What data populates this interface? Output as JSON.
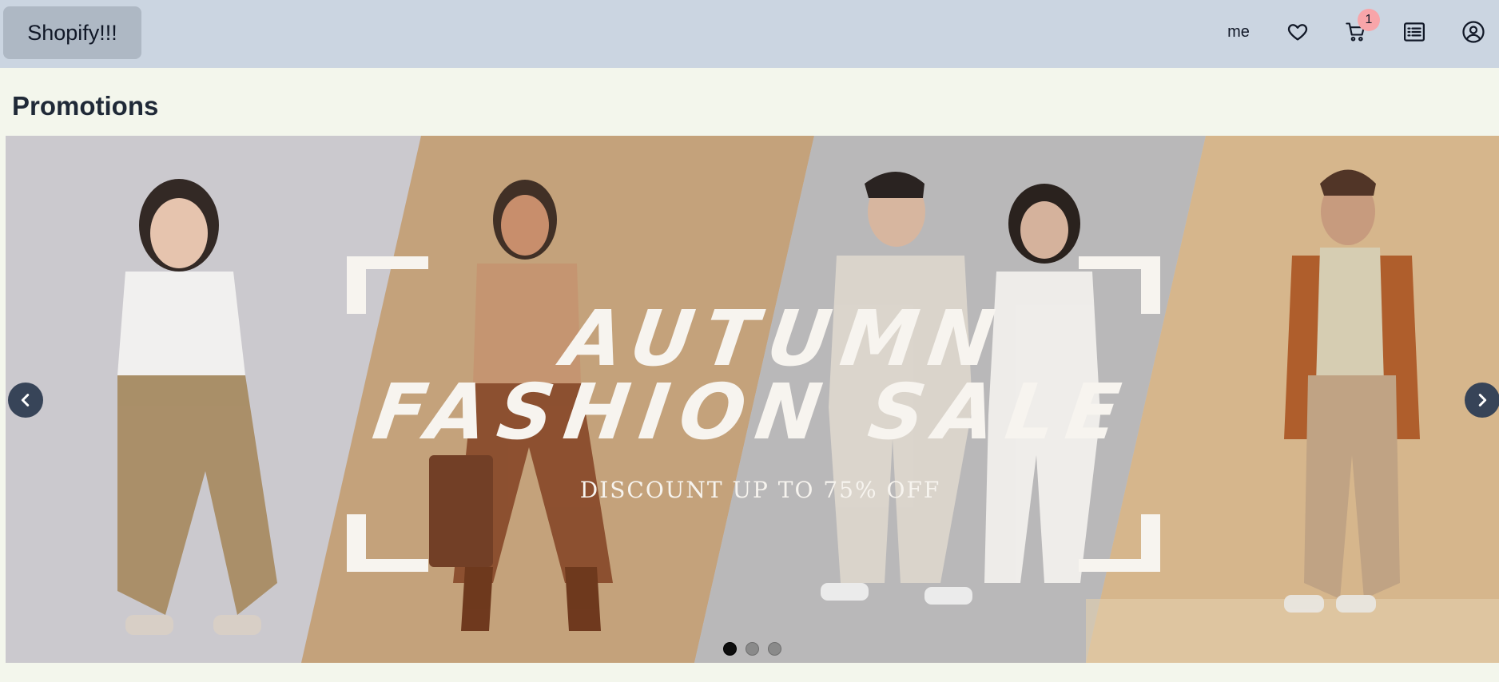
{
  "navbar": {
    "brand": "Shopify!!!",
    "user_label": "me",
    "cart_count": "1",
    "icons": [
      "heart-icon",
      "cart-icon",
      "list-icon",
      "user-circle-icon"
    ]
  },
  "promotions": {
    "title": "Promotions",
    "banner": {
      "line1": "AUTUMN",
      "line2": "FASHION SALE",
      "line3": "DISCOUNT UP TO 75% OFF"
    },
    "slide_count": 3,
    "active_slide": 1
  },
  "colors": {
    "navbar_bg": "#cbd5e1",
    "page_bg": "#f3f6ec",
    "brand_bg": "#aeb8c4",
    "badge_bg": "#f8a5a9",
    "arrow_bg": "#374458"
  }
}
